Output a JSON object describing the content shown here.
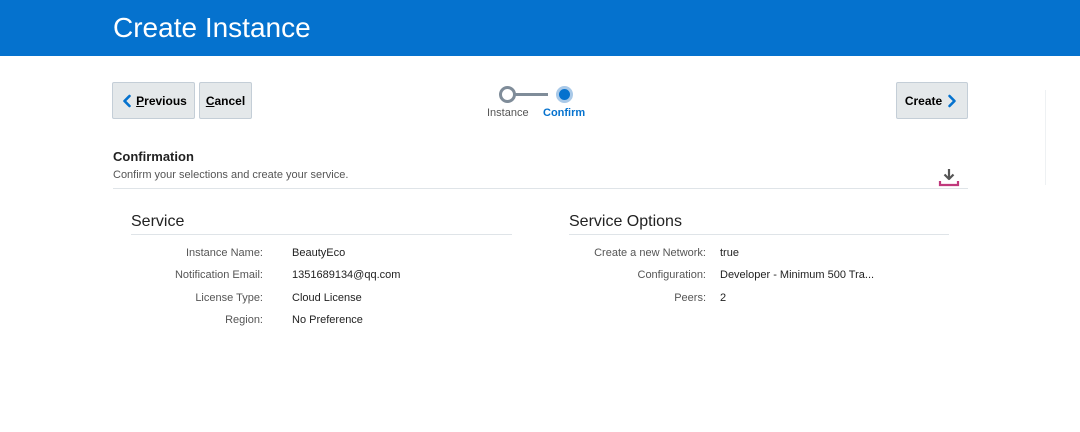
{
  "header": {
    "title": "Create Instance"
  },
  "toolbar": {
    "previous_label_first": "P",
    "previous_label_rest": "revious",
    "cancel_label_first": "C",
    "cancel_label_rest": "ancel",
    "create_label": "Create"
  },
  "train": {
    "steps": [
      {
        "label": "Instance",
        "state": "visited"
      },
      {
        "label": "Confirm",
        "state": "current"
      }
    ]
  },
  "confirmation": {
    "title": "Confirmation",
    "subtitle": "Confirm your selections and create your service."
  },
  "service": {
    "title": "Service",
    "fields": [
      {
        "label": "Instance Name:",
        "value": "BeautyEco"
      },
      {
        "label": "Notification Email:",
        "value": "1351689134@qq.com"
      },
      {
        "label": "License Type:",
        "value": "Cloud License"
      },
      {
        "label": "Region:",
        "value": "No Preference"
      }
    ]
  },
  "service_options": {
    "title": "Service Options",
    "fields": [
      {
        "label": "Create a new Network:",
        "value": "true"
      },
      {
        "label": "Configuration:",
        "value": "Developer - Minimum 500 Tra..."
      },
      {
        "label": "Peers:",
        "value": "2"
      }
    ]
  },
  "colors": {
    "brand": "#0572ce",
    "button_bg": "#e4e8ea",
    "download_accent": "#c0397c"
  },
  "icons": {
    "previous": "chevron-left-icon",
    "next": "chevron-right-icon",
    "download": "download-icon"
  }
}
